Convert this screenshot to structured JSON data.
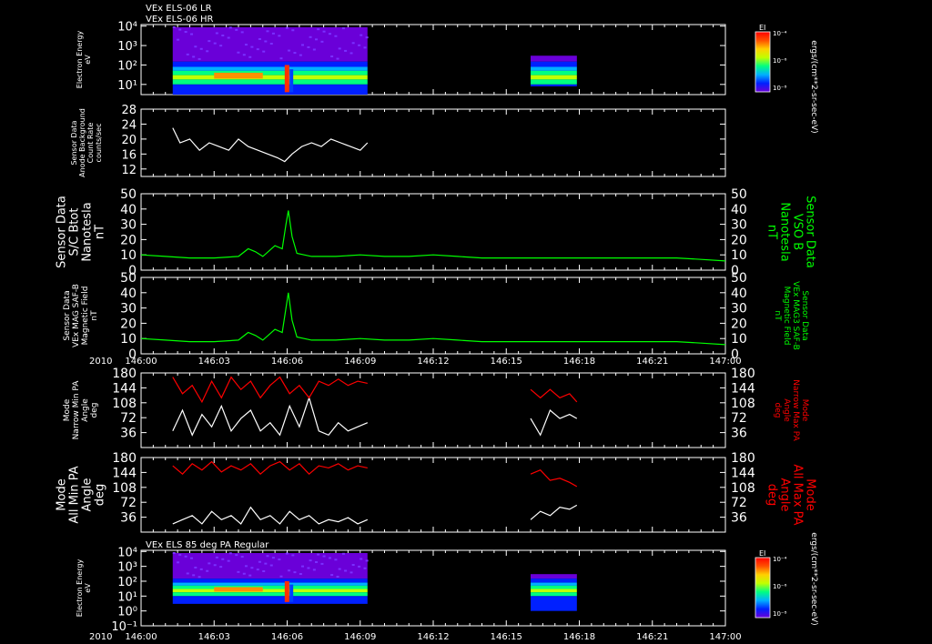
{
  "header": {
    "title_lines": [
      "VEx ELS-06 LR",
      "VEx ELS-06 HR"
    ]
  },
  "colorbar": {
    "label": "EI",
    "units_label": "ergs/(cm**2-sr-sec-eV)",
    "ticks": [
      "10⁻⁴",
      "10⁻⁶",
      "10⁻⁸"
    ],
    "colors": [
      "#6a00d8",
      "#0020ff",
      "#00b0ff",
      "#00ff80",
      "#c0ff00",
      "#ffd000",
      "#ff5000",
      "#ff0000"
    ]
  },
  "time_axis": {
    "year_label": "2010",
    "ticks": [
      "146:00",
      "146:03",
      "146:06",
      "146:09",
      "146:12",
      "146:15",
      "146:18",
      "146:21",
      "147:00"
    ]
  },
  "colors": {
    "background": "#000000",
    "axes": "#ffffff",
    "green": "#00ff00",
    "red": "#ff0000",
    "white": "#ffffff"
  },
  "chart_data": [
    {
      "type": "heatmap",
      "title": "VEx ELS-06 LR / VEx ELS-06 HR",
      "ylabel": [
        "Electron Energy",
        "eV"
      ],
      "yscale": "log",
      "yticks": [
        "10⁴",
        "10³",
        "10²",
        "10¹"
      ],
      "ylim": [
        3,
        12000
      ],
      "segments": [
        {
          "start": "146:01.3",
          "end": "146:09.3"
        },
        {
          "start": "146:16.0",
          "end": "146:17.9"
        }
      ],
      "colorbar_label": "EI"
    },
    {
      "type": "line",
      "ylabel": [
        "Sensor Data",
        "Anode Background",
        "Count Rate",
        "counts/sec"
      ],
      "ylim": [
        10,
        28
      ],
      "yticks": [
        12,
        16,
        20,
        24,
        28
      ],
      "series": [
        {
          "color": "#ffffff",
          "x": [
            1.3,
            1.6,
            2.0,
            2.4,
            2.8,
            3.2,
            3.6,
            4.0,
            4.4,
            4.8,
            5.2,
            5.6,
            5.9,
            6.2,
            6.6,
            7.0,
            7.4,
            7.8,
            8.2,
            8.6,
            9.0,
            9.3
          ],
          "values": [
            23,
            19,
            20,
            17,
            19,
            18,
            17,
            20,
            18,
            17,
            16,
            15,
            14,
            16,
            18,
            19,
            18,
            20,
            19,
            18,
            17,
            19
          ]
        }
      ]
    },
    {
      "type": "line",
      "ylabel": [
        "Sensor Data",
        "S/C Btot",
        "Nanotesla",
        "nT"
      ],
      "ylabel_right": [
        "Sensor Data",
        "VSO B",
        "Nanotesla",
        "nT"
      ],
      "ylim": [
        0,
        50
      ],
      "yticks": [
        0,
        10,
        20,
        30,
        40,
        50
      ],
      "series": [
        {
          "color": "#00ff00",
          "x": [
            0,
            1,
            2,
            3,
            4,
            4.4,
            4.7,
            5.0,
            5.5,
            5.8,
            5.95,
            6.05,
            6.2,
            6.4,
            7,
            8,
            9,
            10,
            11,
            12,
            13,
            14,
            15,
            16,
            17,
            18,
            19,
            20,
            21,
            22,
            23,
            24
          ],
          "values": [
            10,
            9,
            8,
            8,
            9,
            14,
            12,
            9,
            16,
            14,
            30,
            39,
            22,
            11,
            9,
            9,
            10,
            9,
            9,
            10,
            9,
            8,
            8,
            8,
            8,
            8,
            8,
            8,
            8,
            8,
            7,
            6
          ]
        }
      ]
    },
    {
      "type": "line",
      "ylabel": [
        "Sensor Data",
        "VEx MAG SAF-B",
        "Magnetic Field",
        "nT"
      ],
      "ylabel_right": [
        "Sensor Data",
        "VEx MAG3 SAF-B",
        "Magnetic Field",
        "nT"
      ],
      "ylim": [
        0,
        50
      ],
      "yticks": [
        0,
        10,
        20,
        30,
        40,
        50
      ],
      "series": [
        {
          "color": "#00ff00",
          "x": [
            0,
            1,
            2,
            3,
            4,
            4.4,
            4.7,
            5.0,
            5.5,
            5.8,
            5.95,
            6.05,
            6.2,
            6.4,
            7,
            8,
            9,
            10,
            11,
            12,
            13,
            14,
            15,
            16,
            17,
            18,
            19,
            20,
            21,
            22,
            23,
            24
          ],
          "values": [
            10,
            9,
            8,
            8,
            9,
            14,
            12,
            9,
            16,
            14,
            30,
            40,
            22,
            11,
            9,
            9,
            10,
            9,
            9,
            10,
            9,
            8,
            8,
            8,
            8,
            8,
            8,
            8,
            8,
            8,
            7,
            6
          ]
        }
      ]
    },
    {
      "type": "line",
      "ylabel": [
        "Mode",
        "Narrow Min PA",
        "Angle",
        "deg"
      ],
      "ylabel_right": [
        "Mode",
        "Narrow Max PA",
        "Angle",
        "deg"
      ],
      "ylim": [
        0,
        180
      ],
      "yticks": [
        36,
        72,
        108,
        144,
        180
      ],
      "series": [
        {
          "color": "#ffffff",
          "x": [
            1.3,
            1.7,
            2.1,
            2.5,
            2.9,
            3.3,
            3.7,
            4.1,
            4.5,
            4.9,
            5.3,
            5.7,
            6.1,
            6.5,
            6.9,
            7.3,
            7.7,
            8.1,
            8.5,
            8.9,
            9.3,
            16.0,
            16.4,
            16.8,
            17.2,
            17.6,
            17.9
          ],
          "values": [
            40,
            90,
            30,
            80,
            50,
            100,
            40,
            70,
            90,
            40,
            60,
            30,
            100,
            50,
            120,
            40,
            30,
            60,
            40,
            50,
            60,
            70,
            30,
            90,
            70,
            80,
            70
          ]
        },
        {
          "color": "#ff0000",
          "x": [
            1.3,
            1.7,
            2.1,
            2.5,
            2.9,
            3.3,
            3.7,
            4.1,
            4.5,
            4.9,
            5.3,
            5.7,
            6.1,
            6.5,
            6.9,
            7.3,
            7.7,
            8.1,
            8.5,
            8.9,
            9.3,
            16.0,
            16.4,
            16.8,
            17.2,
            17.6,
            17.9
          ],
          "values": [
            170,
            130,
            150,
            110,
            160,
            120,
            170,
            140,
            160,
            120,
            150,
            170,
            130,
            150,
            120,
            160,
            150,
            165,
            150,
            160,
            155,
            140,
            120,
            140,
            120,
            130,
            110
          ]
        }
      ]
    },
    {
      "type": "line",
      "ylabel": [
        "Mode",
        "All Min PA",
        "Angle",
        "deg"
      ],
      "ylabel_right": [
        "Mode",
        "All Max PA",
        "Angle",
        "deg"
      ],
      "ylim": [
        0,
        180
      ],
      "yticks": [
        36,
        72,
        108,
        144,
        180
      ],
      "series": [
        {
          "color": "#ffffff",
          "x": [
            1.3,
            1.7,
            2.1,
            2.5,
            2.9,
            3.3,
            3.7,
            4.1,
            4.5,
            4.9,
            5.3,
            5.7,
            6.1,
            6.5,
            6.9,
            7.3,
            7.7,
            8.1,
            8.5,
            8.9,
            9.3,
            16.0,
            16.4,
            16.8,
            17.2,
            17.6,
            17.9
          ],
          "values": [
            20,
            30,
            40,
            20,
            50,
            30,
            40,
            20,
            60,
            30,
            40,
            20,
            50,
            30,
            40,
            20,
            30,
            25,
            35,
            20,
            30,
            30,
            50,
            40,
            60,
            55,
            65
          ]
        },
        {
          "color": "#ff0000",
          "x": [
            1.3,
            1.7,
            2.1,
            2.5,
            2.9,
            3.3,
            3.7,
            4.1,
            4.5,
            4.9,
            5.3,
            5.7,
            6.1,
            6.5,
            6.9,
            7.3,
            7.7,
            8.1,
            8.5,
            8.9,
            9.3,
            16.0,
            16.4,
            16.8,
            17.2,
            17.6,
            17.9
          ],
          "values": [
            160,
            140,
            165,
            150,
            170,
            145,
            160,
            150,
            165,
            140,
            160,
            170,
            150,
            165,
            140,
            160,
            155,
            165,
            150,
            160,
            155,
            140,
            150,
            125,
            130,
            120,
            110
          ]
        }
      ]
    },
    {
      "type": "heatmap",
      "title": "VEx ELS 85 deg PA Regular",
      "ylabel": [
        "Electron Energy",
        "eV"
      ],
      "yscale": "log",
      "yticks": [
        "10⁴",
        "10³",
        "10²",
        "10¹",
        "10⁰",
        "10⁻¹"
      ],
      "ylim": [
        0.1,
        12000
      ],
      "segments": [
        {
          "start": "146:01.3",
          "end": "146:09.3"
        },
        {
          "start": "146:16.0",
          "end": "146:17.9"
        }
      ],
      "colorbar_label": "EI"
    }
  ]
}
